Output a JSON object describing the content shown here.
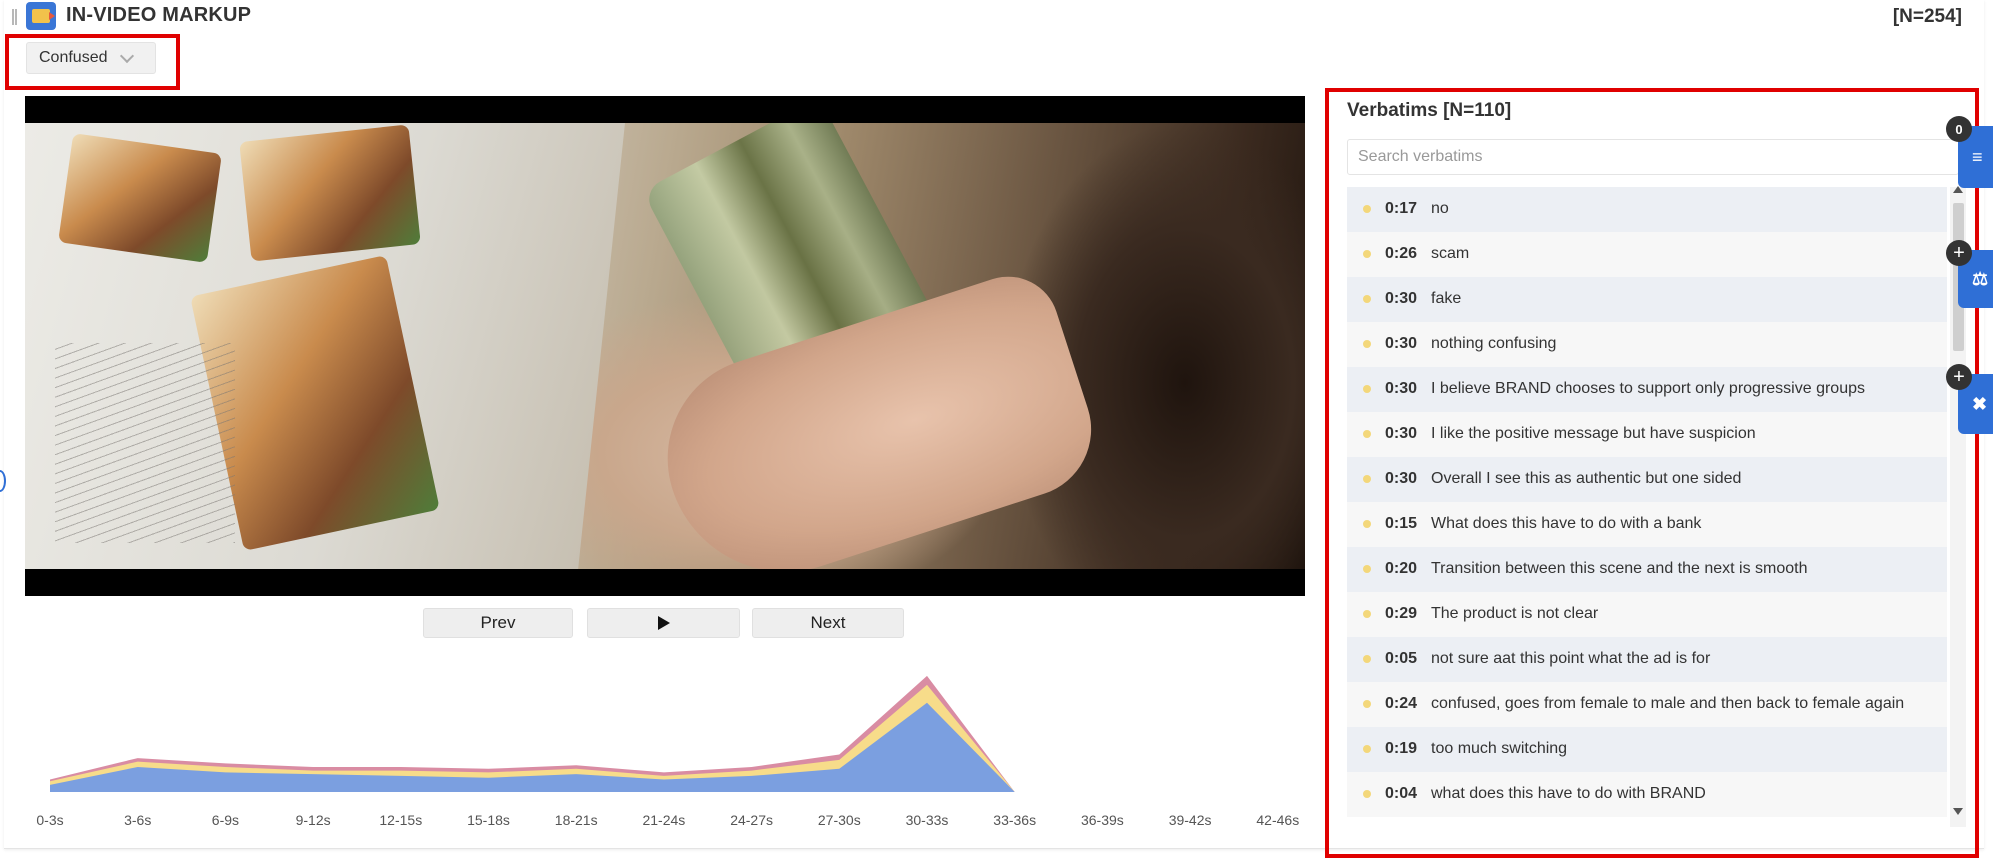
{
  "header": {
    "title": "IN-VIDEO MARKUP",
    "count": "[N=254]",
    "colors": {
      "accent": "#2f6fd6",
      "highlight": "#e00000"
    }
  },
  "filter": {
    "selected": "Confused"
  },
  "player": {
    "prev_label": "Prev",
    "play_icon": "play-icon",
    "next_label": "Next"
  },
  "chart_data": {
    "type": "area",
    "categories": [
      "0-3s",
      "3-6s",
      "6-9s",
      "9-12s",
      "12-15s",
      "15-18s",
      "18-21s",
      "21-24s",
      "24-27s",
      "27-30s",
      "30-33s",
      "33-36s",
      "36-39s",
      "39-42s",
      "42-46s"
    ],
    "series": [
      {
        "values": [
          4,
          14,
          11,
          10,
          9,
          8,
          10,
          7,
          9,
          13,
          50,
          0,
          0,
          0,
          0
        ],
        "color": "#7b9fe0"
      },
      {
        "values": [
          2,
          3,
          3,
          2,
          3,
          3,
          3,
          2,
          3,
          5,
          10,
          0,
          0,
          0,
          0
        ],
        "color": "#f7dc8a"
      },
      {
        "values": [
          1,
          2,
          2,
          2,
          2,
          2,
          2,
          2,
          2,
          3,
          5,
          0,
          0,
          0,
          0
        ],
        "color": "#d98ca3"
      }
    ],
    "ylim": [
      0,
      70
    ],
    "grid": false,
    "legend": "none"
  },
  "verbatims": {
    "title": "Verbatims [N=110]",
    "search_placeholder": "Search verbatims",
    "filter_badge": "0",
    "items": [
      {
        "time": "0:17",
        "text": "no"
      },
      {
        "time": "0:26",
        "text": "scam"
      },
      {
        "time": "0:30",
        "text": "fake"
      },
      {
        "time": "0:30",
        "text": "nothing confusing"
      },
      {
        "time": "0:30",
        "text": "I believe BRAND chooses to support only progressive groups"
      },
      {
        "time": "0:30",
        "text": "I like the positive message but have suspicion"
      },
      {
        "time": "0:30",
        "text": "Overall I see this as authentic but one sided"
      },
      {
        "time": "0:15",
        "text": "What does this have to do with a bank"
      },
      {
        "time": "0:20",
        "text": "Transition between this scene and the next is smooth"
      },
      {
        "time": "0:29",
        "text": "The product is not clear"
      },
      {
        "time": "0:05",
        "text": "not sure aat this point what the ad is for"
      },
      {
        "time": "0:24",
        "text": "confused, goes from female to male and then back to female again"
      },
      {
        "time": "0:19",
        "text": "too much switching"
      },
      {
        "time": "0:04",
        "text": "what does this have to do with BRAND"
      }
    ]
  }
}
